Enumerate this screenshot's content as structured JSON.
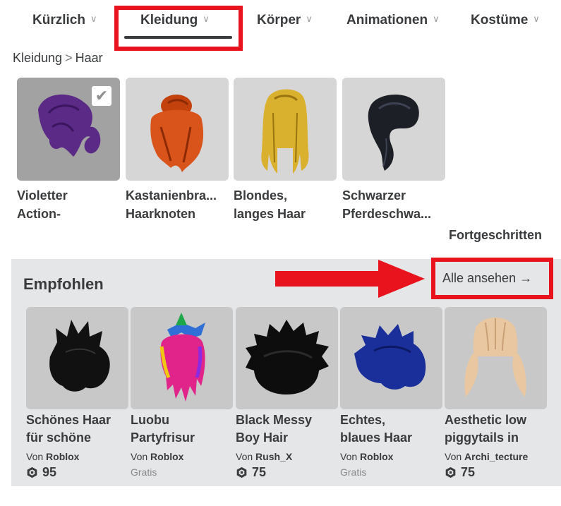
{
  "tabs": [
    {
      "label": "Kürzlich"
    },
    {
      "label": "Kleidung"
    },
    {
      "label": "Körper"
    },
    {
      "label": "Animationen"
    },
    {
      "label": "Kostüme"
    }
  ],
  "active_tab": "Kleidung",
  "breadcrumb": {
    "parent": "Kleidung",
    "separator": ">",
    "current": "Haar"
  },
  "owned_items": [
    {
      "line1": "Violetter",
      "line2": "Action-",
      "selected": true,
      "hair_color": "#5b2a86"
    },
    {
      "line1": "Kastanienbra...",
      "line2": "Haarknoten",
      "selected": false,
      "hair_color": "#c2410c"
    },
    {
      "line1": "Blondes,",
      "line2": "langes Haar",
      "selected": false,
      "hair_color": "#d4a82a"
    },
    {
      "line1": "Schwarzer",
      "line2": "Pferdeschwa...",
      "selected": false,
      "hair_color": "#1c1f26"
    }
  ],
  "advanced_label": "Fortgeschritten",
  "recommended": {
    "title": "Empfohlen",
    "see_all": "Alle ansehen →",
    "items": [
      {
        "line1": "Schönes Haar",
        "line2": "für schöne",
        "by_prefix": "Von",
        "creator": "Roblox",
        "price": "95",
        "free": "",
        "hair_color": "#111111"
      },
      {
        "line1": "Luobu",
        "line2": "Partyfrisur",
        "by_prefix": "Von",
        "creator": "Roblox",
        "price": "",
        "free": "Gratis",
        "hair_color": "#e0248a"
      },
      {
        "line1": "Black Messy",
        "line2": "Boy Hair",
        "by_prefix": "Von",
        "creator": "Rush_X",
        "price": "75",
        "free": "",
        "hair_color": "#0d0d0d"
      },
      {
        "line1": "Echtes,",
        "line2": "blaues Haar",
        "by_prefix": "Von",
        "creator": "Roblox",
        "price": "",
        "free": "Gratis",
        "hair_color": "#1a2f9a"
      },
      {
        "line1": "Aesthetic low",
        "line2": "piggytails in",
        "by_prefix": "Von",
        "creator": "Archi_tecture",
        "price": "75",
        "free": "",
        "hair_color": "#e9c7a0"
      }
    ]
  },
  "colors": {
    "highlight": "#e8131c",
    "text": "#393b3d",
    "section_bg": "#e4e6e8"
  }
}
